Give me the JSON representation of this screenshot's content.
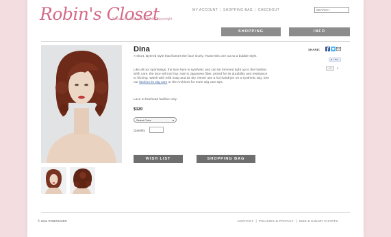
{
  "brand": {
    "logo_text": "Robin's Closet",
    "tagline": "Social Vocabulary and Web Copywright"
  },
  "top_nav": {
    "items": [
      "MY ACCOUNT",
      "SHOPPING BAG",
      "CHECKOUT"
    ],
    "separator": "|",
    "search_placeholder": "SEARCH"
  },
  "main_nav": {
    "shopping": "SHOPPING",
    "info": "INFO"
  },
  "product": {
    "name": "Dina",
    "desc_1": "A short, layered style that frames the face nicely. Tease this one out to a bubble style.",
    "desc_2_prefix": "Like all our sportswigs, the lace here is synthetic and can be trimmed right up to the hairline. With care, the lace will not fray. Hair is Japanese fiber, prized for its durability and resistance to frizzing. Wash with mild soap and air dry. Never use a hot hairdryer on a synthetic wig. See our ",
    "desc_2_link": "fashion tin wig care",
    "desc_2_suffix": " or the Archives for more wig care tips.",
    "desc_3": "Lace to forehead hairline only.",
    "price": "$120",
    "select_label": "Select Color",
    "quantity_label": "Quantity",
    "wishlist_label": "WISH LIST",
    "shopping_bag_label": "SHOPPING BAG"
  },
  "share": {
    "label": "SHARE:",
    "fb_like": "Like",
    "gplus": "+1",
    "gplus_count": "0"
  },
  "footer": {
    "copyright": "© 2011 ROBINCOER",
    "links": [
      "CONTACT",
      "POLICIES & PRIVACY",
      "SIZE & COLOR CHARTS"
    ],
    "separator": "|"
  },
  "colors": {
    "background": "#f3dde0",
    "brand_pink": "#d46b8a",
    "nav_gray": "#8c8c8c",
    "button_gray": "#6f6f6f"
  }
}
